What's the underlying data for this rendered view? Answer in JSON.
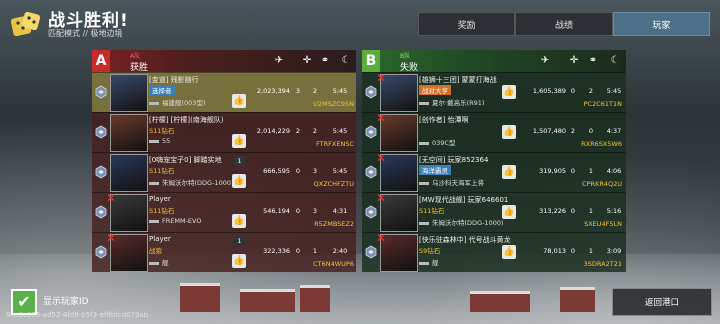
{
  "header": {
    "title": "战斗胜利!",
    "subtitle": "匹配模式 // 极地边境",
    "logo_icon": "dice-icon"
  },
  "tabs": [
    {
      "label": "奖励",
      "active": false
    },
    {
      "label": "战绩",
      "active": false
    },
    {
      "label": "玩家",
      "active": true
    }
  ],
  "team_a": {
    "badge": "A",
    "name": "A队",
    "result": "获胜",
    "color": "#c92a2a",
    "header_icons": [
      "plane-icon",
      "crosshair-icon",
      "handshake-icon",
      "moon-icon"
    ],
    "players": [
      {
        "name": "[变道] 残影随行",
        "rank": "选择者",
        "rank_style": "blue",
        "ship": "福建舰(003型)",
        "score": "2,023,394",
        "k": "3",
        "d": "2",
        "t": "5:45",
        "id": "U2MSZC95N",
        "me": true,
        "dead": false,
        "like_count": ""
      },
      {
        "name": "[柠檬] [柠檬](南海舰队)",
        "rank": "S11钻石",
        "rank_style": "gold",
        "ship": "55",
        "score": "2,014,229",
        "k": "2",
        "d": "2",
        "t": "5:45",
        "id": "FTRFXENSC",
        "me": false,
        "dead": false,
        "like_count": ""
      },
      {
        "name": "[0嗨宠宝子0] 脚踏实地",
        "rank": "S11钻石",
        "rank_style": "gold",
        "ship": "朱姆沃尔特(DDG-1000)",
        "score": "666,595",
        "k": "0",
        "d": "3",
        "t": "5:45",
        "id": "QXZCHFZTU",
        "me": false,
        "dead": false,
        "like_count": "1"
      },
      {
        "name": "Player",
        "rank": "S11钻石",
        "rank_style": "gold",
        "ship": "FREMM-EVO",
        "score": "546,194",
        "k": "0",
        "d": "3",
        "t": "4:31",
        "id": "R5ZMBSEZ2",
        "me": false,
        "dead": true,
        "like_count": ""
      },
      {
        "name": "Player",
        "rank": "战狼",
        "rank_style": "gold",
        "ship": "舰",
        "score": "322,336",
        "k": "0",
        "d": "1",
        "t": "2:40",
        "id": "CT6N4WUP6",
        "me": false,
        "dead": true,
        "like_count": "1"
      }
    ]
  },
  "team_b": {
    "badge": "B",
    "name": "B队",
    "result": "失败",
    "color": "#5cae3c",
    "header_icons": [
      "plane-icon",
      "crosshair-icon",
      "handshake-icon",
      "moon-icon"
    ],
    "players": [
      {
        "name": "[雄狮十三团] 蒙蒙打海战",
        "rank": "战对大亨",
        "rank_style": "orange",
        "ship": "夏尔·戴高乐(R91)",
        "score": "1,605,389",
        "k": "0",
        "d": "2",
        "t": "5:45",
        "id": "PC2C61T1N",
        "dead": true
      },
      {
        "name": "[创作者] 怡潭啊",
        "rank": "",
        "rank_style": "gold",
        "ship": "039C型",
        "score": "1,507,480",
        "k": "2",
        "d": "0",
        "t": "4:37",
        "id": "RXR6SX5W6",
        "dead": true
      },
      {
        "name": "[无空间] 玩家852364",
        "rank": "海洋霸灵",
        "rank_style": "blue",
        "ship": "乌沙科夫海军上将",
        "score": "319,905",
        "k": "0",
        "d": "1",
        "t": "4:06",
        "id": "CPRKR4Q2U",
        "dead": true
      },
      {
        "name": "[MW现代战舰] 玩家646601",
        "rank": "S11钻石",
        "rank_style": "gold",
        "ship": "朱姆沃尔特(DDG-1000)",
        "score": "313,226",
        "k": "0",
        "d": "1",
        "t": "5:16",
        "id": "SXEU4F5LN",
        "dead": true
      },
      {
        "name": "[快乐驻森林中] 代号战斗黄龙",
        "rank": "S9钻石",
        "rank_style": "gold",
        "ship": "舰",
        "score": "78,013",
        "k": "0",
        "d": "1",
        "t": "3:09",
        "id": "3SDRA2T21",
        "dead": true
      }
    ]
  },
  "footer": {
    "show_id_label": "显示玩家ID",
    "show_id_checked": true,
    "watermark": "9ec9c505-ad52-4fd9-b5f3-ef9bfcd079ab",
    "back_label": "返回港口"
  }
}
